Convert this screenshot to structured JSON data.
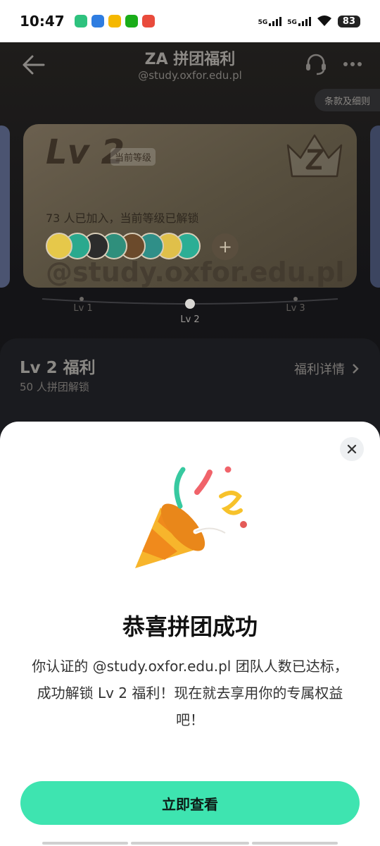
{
  "status_bar": {
    "time": "10:47",
    "network1": "5G",
    "network2": "5G",
    "battery": "83"
  },
  "header": {
    "title": "ZA 拼团福利",
    "subtitle": "@study.oxfor.edu.pl",
    "terms_label": "条款及细则"
  },
  "level_card": {
    "level": "Lv 2",
    "current_tag": "当前等级",
    "joined_text": "73 人已加入，当前等级已解锁",
    "watermark": "@study.oxfor.edu.pl",
    "avatar_colors": [
      "#e6c84a",
      "#2aa98e",
      "#2c2c2c",
      "#2f8f7c",
      "#6b4a2b",
      "#2f8f88",
      "#e0c04a",
      "#2cae95"
    ]
  },
  "levels": [
    {
      "label": "Lv 1"
    },
    {
      "label": "Lv 2"
    },
    {
      "label": "Lv 3"
    }
  ],
  "benefit": {
    "title": "Lv 2 福利",
    "subtitle": "50 人拼团解锁",
    "details_link": "福利详情"
  },
  "modal": {
    "title": "恭喜拼团成功",
    "body": "你认证的 @study.oxfor.edu.pl 团队人数已达标，成功解锁 Lv 2 福利！现在就去享用你的专属权益吧！",
    "cta": "立即查看"
  },
  "colors": {
    "accent": "#3ee4b0",
    "sheet_bg": "#ffffff",
    "page_bg": "#141417"
  }
}
